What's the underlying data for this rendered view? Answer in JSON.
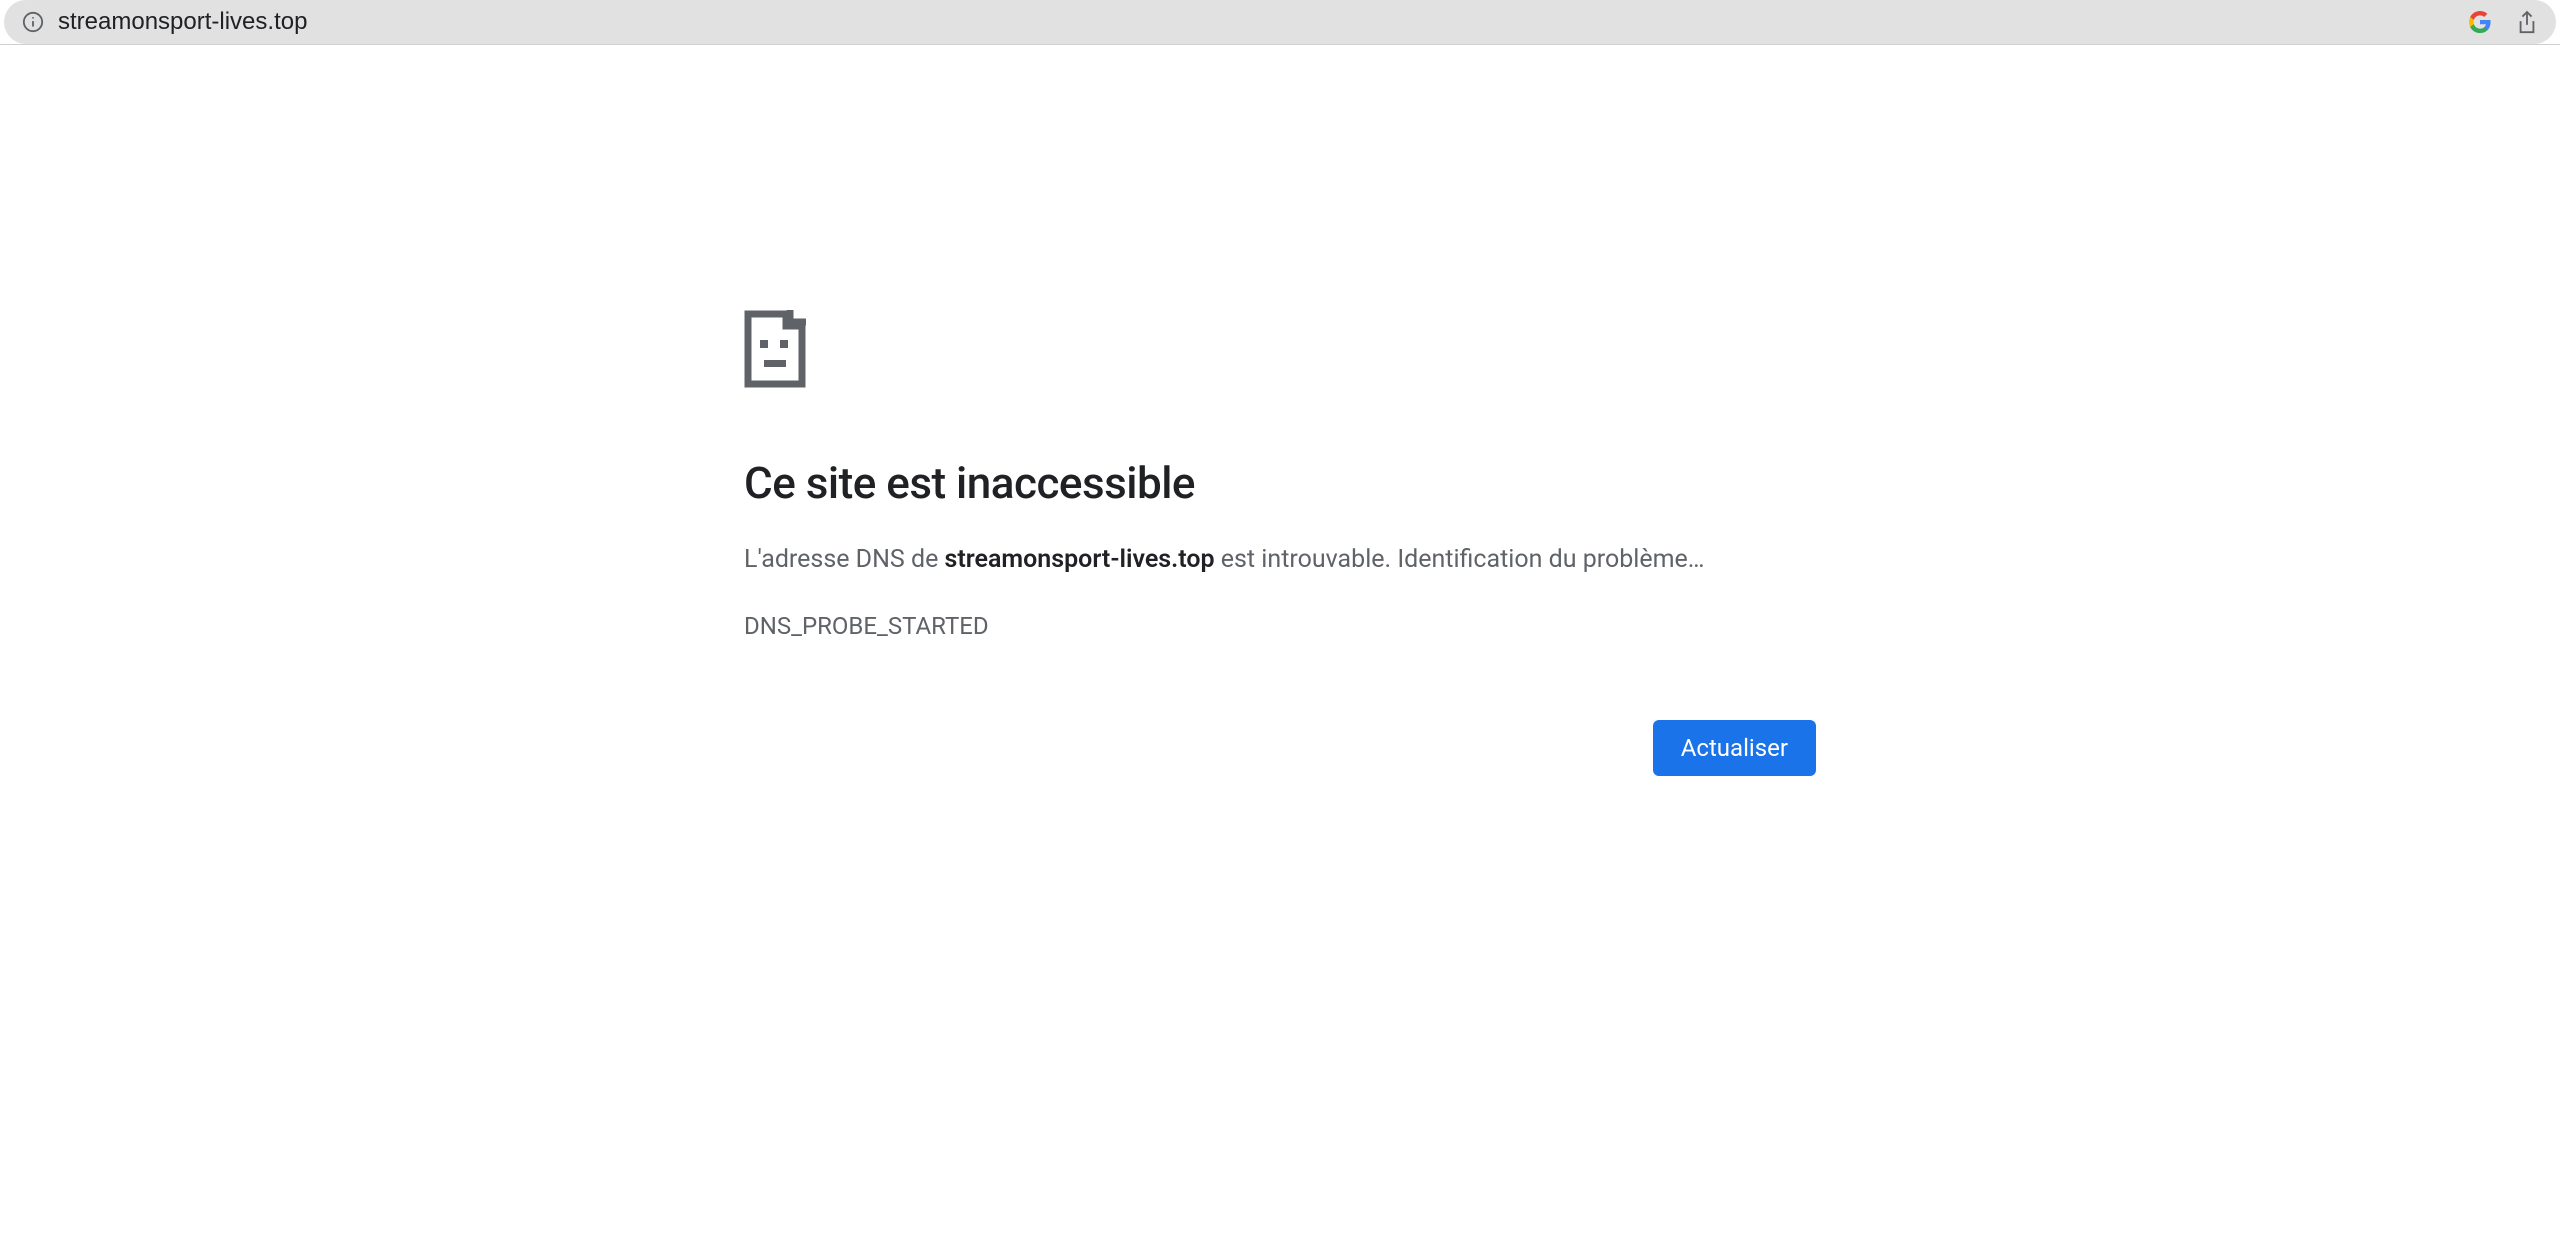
{
  "addressBar": {
    "url": "streamonsport-lives.top"
  },
  "error": {
    "title": "Ce site est inaccessible",
    "messagePart1": "L'adresse DNS de ",
    "domain": "streamonsport-lives.top",
    "messagePart2": " est introuvable. Identification du problème…",
    "code": "DNS_PROBE_STARTED",
    "reloadLabel": "Actualiser"
  }
}
